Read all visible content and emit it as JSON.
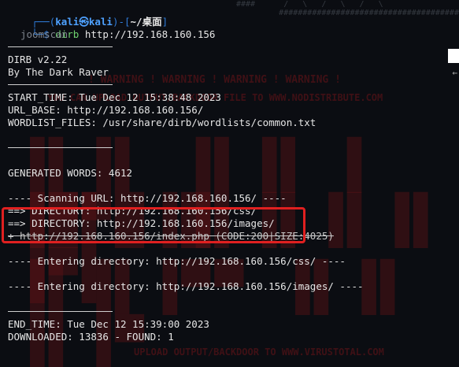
{
  "prompt": {
    "corner_top": "┌──(",
    "user": "kali㉿kali",
    "sep": ")-[",
    "path": "~/桌面",
    "close": "]",
    "corner_bottom": "└─$ ",
    "command_name": "dirb",
    "command_args": " http://192.168.160.156"
  },
  "ghost_text": "joomscan",
  "header": {
    "version": "DIRB v2.22",
    "author": "By The Dark Raver"
  },
  "info": {
    "start_time": "START_TIME: Tue Dec 12 15:38:48 2023",
    "url_base": "URL_BASE: http://192.168.160.156/",
    "wordlist": "WORDLIST_FILES: /usr/share/dirb/wordlists/common.txt"
  },
  "generated": "GENERATED WORDS: 4612",
  "scan": {
    "scanning": "---- Scanning URL: http://192.168.160.156/ ----",
    "dir1": "==> DIRECTORY: http://192.168.160.156/css/",
    "dir2": "==> DIRECTORY: http://192.168.160.156/images/",
    "found": "+ http://192.168.160.156/index.php (CODE:200|SIZE:4025)"
  },
  "entering": {
    "css": "---- Entering directory: http://192.168.160.156/css/ ----",
    "images": "---- Entering directory: http://192.168.160.156/images/ ----"
  },
  "summary": {
    "end_time": "END_TIME: Tue Dec 12 15:39:00 2023",
    "downloaded": "DOWNLOADED: 13836 - FOUND: 1"
  },
  "watermark": {
    "warning": "! WARNING ! WARNING ! WARNING ! WARNING !",
    "nodistribute": "YOU CAN UPLOAD OUTPUT/BACKDOOR FILE TO WWW.NODISTRIBUTE.COM",
    "virustotal": "UPLOAD OUTPUT/BACKDOOR TO WWW.VIRUSTOTAL.COM"
  },
  "colors": {
    "background": "#0b0d12",
    "prompt_blue": "#2f7bd8",
    "highlight_red": "#e02020"
  }
}
